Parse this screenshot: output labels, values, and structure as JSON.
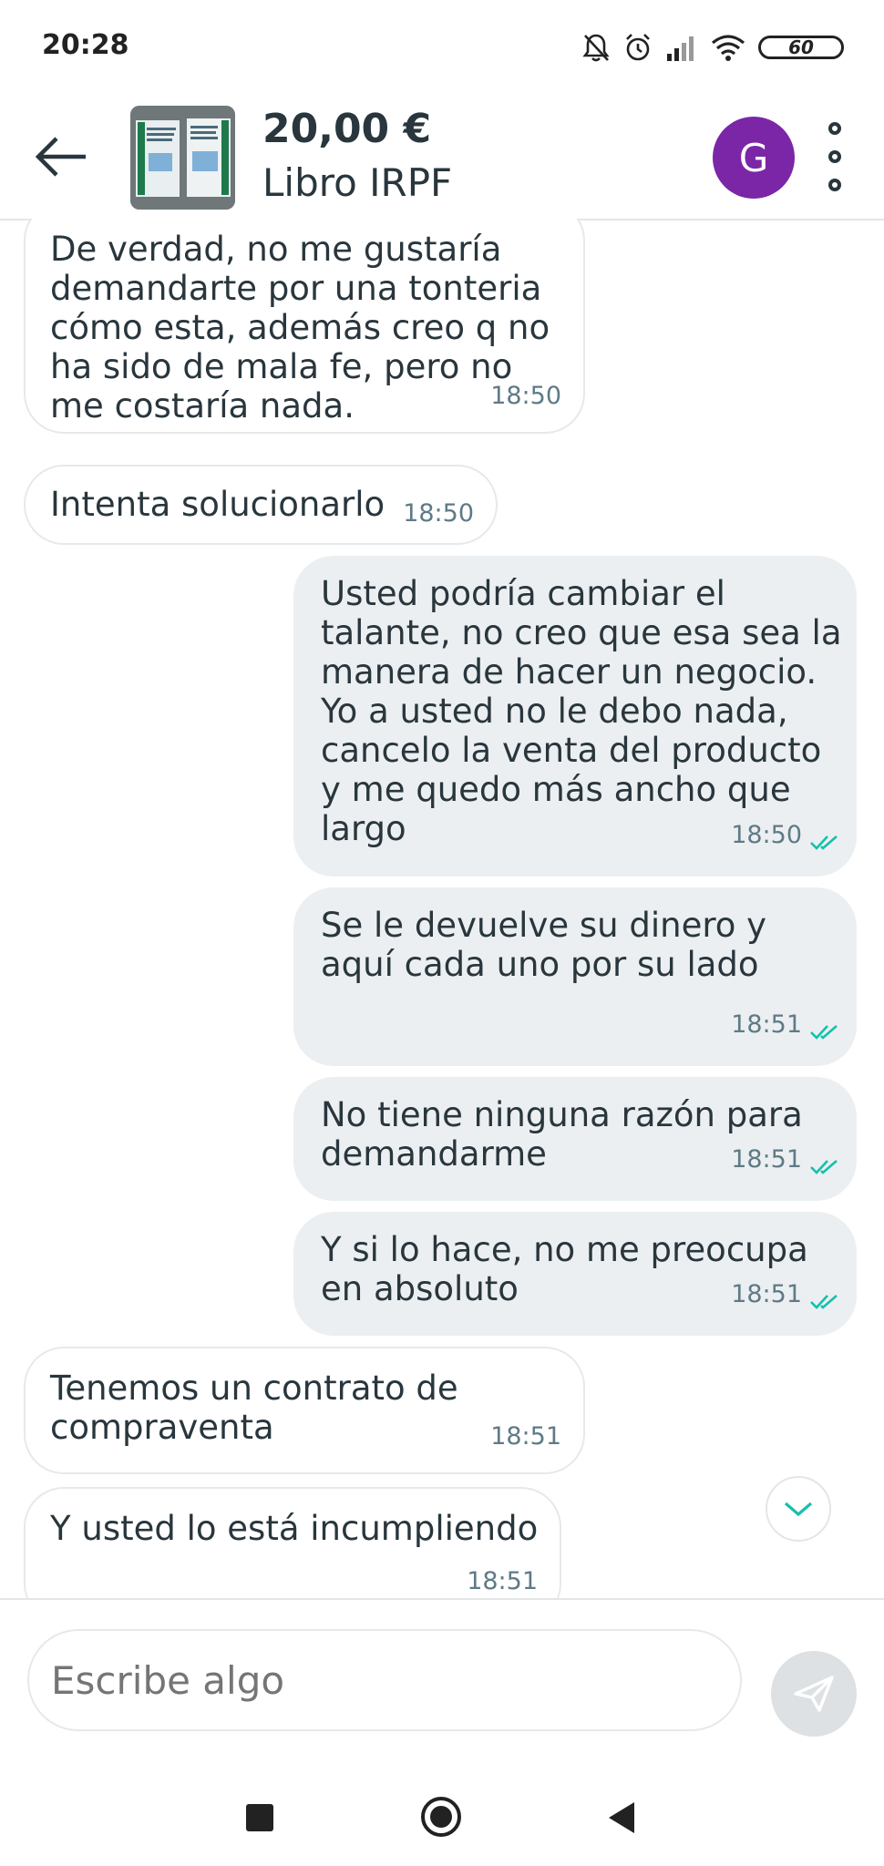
{
  "status_bar": {
    "time": "20:28",
    "battery": "60",
    "icons": [
      "bell-off-icon",
      "alarm-icon",
      "signal-icon",
      "wifi-icon",
      "battery-icon"
    ]
  },
  "header": {
    "price": "20,00 €",
    "title": "Libro IRPF",
    "avatar_letter": "G",
    "avatar_color": "#7b26a6"
  },
  "messages": [
    {
      "direction": "in",
      "text": "De verdad, no me gustaría\ndemandarte por una tonteria\ncómo esta, además creo q no\nha sido de mala fe, pero no\nme costaría nada.",
      "time": "18:50"
    },
    {
      "direction": "in",
      "text": "Intenta solucionarlo",
      "time": "18:50"
    },
    {
      "direction": "out",
      "text": "Usted podría cambiar el\ntalante, no creo que esa sea la\nmanera de hacer un negocio.\nYo a usted no le debo nada,\ncancelo la venta del producto\ny me quedo más ancho que\nlargo",
      "time": "18:50",
      "read": true
    },
    {
      "direction": "out",
      "text": "Se le devuelve su dinero y\naquí cada uno por su lado",
      "time": "18:51",
      "read": true
    },
    {
      "direction": "out",
      "text": "No tiene ninguna razón para\ndemandarme",
      "time": "18:51",
      "read": true
    },
    {
      "direction": "out",
      "text": "Y si lo hace, no me preocupa\nen absoluto",
      "time": "18:51",
      "read": true
    },
    {
      "direction": "in",
      "text": "Tenemos un contrato de\ncompraventa",
      "time": "18:51"
    },
    {
      "direction": "in",
      "text": "Y usted lo está incumpliendo",
      "time": "18:51"
    }
  ],
  "composer": {
    "placeholder": "Escribe algo"
  },
  "colors": {
    "read_ticks": "#13c1ac",
    "outgoing_bubble": "#eceff1",
    "text": "#29363d"
  }
}
